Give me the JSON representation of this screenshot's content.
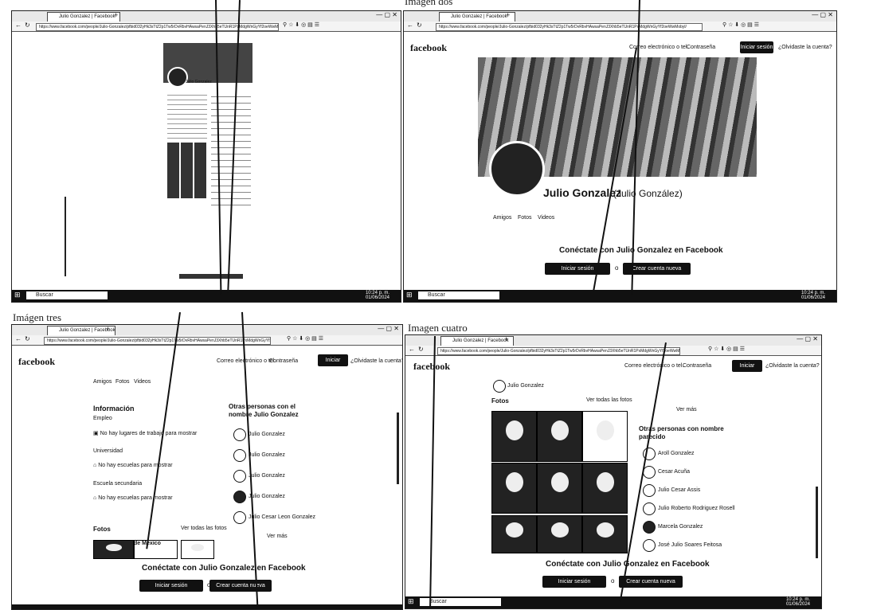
{
  "captions": {
    "two": "Imagen dos",
    "three": "Imágen tres",
    "four": "Imagen cuatro"
  },
  "browser": {
    "tab_title": "Julio Gonzalez | Facebook",
    "url": "https://www.facebook.com/people/Julio-Gonzalez/pfbid032yHk3sTtZ2p1Tw5rDvRbvHAwsaPenJ3Xhb5eTUnR1PxMdgWnGyYf2oeWwMobyl/"
  },
  "taskbar": {
    "search": "Buscar",
    "time": "10:24 p. m.",
    "date": "01/06/2024"
  },
  "fb": {
    "logo": "facebook",
    "email": "Correo electrónico o tel.",
    "password": "Contraseña",
    "login": "Iniciar sesión",
    "forgot": "¿Olvidaste la cuenta?",
    "profile_name": "Julio Gonzalez",
    "alt_name": "(Julio González)",
    "tabs": [
      "Amigos",
      "Fotos",
      "Videos"
    ],
    "connect": "Conéctate con Julio Gonzalez en Facebook",
    "create": "Crear cuenta nueva",
    "or": "o"
  },
  "info": {
    "title": "Información",
    "employment": "Empleo",
    "no_work": "No hay lugares de trabajo para mostrar",
    "university": "Universidad",
    "no_schools": "No hay escuelas para mostrar",
    "highschool": "Escuela secundaria",
    "no_schools2": "No hay escuelas para mostrar",
    "photos": "Fotos",
    "see_all": "Ver todas las fotos",
    "see_more": "Ver más"
  },
  "others_same": {
    "title": "Otras personas con el nombre Julio Gonzalez",
    "people": [
      "Julio Gonzalez",
      "Julio Gonzalez",
      "Julio Gonzalez",
      "Julio Gonzalez",
      "Julio Cesar Leon Gonzalez"
    ]
  },
  "others_similar": {
    "title": "Otras personas con nombre parecido",
    "people": [
      "Aroll Gonzalez",
      "Cesar Acuña",
      "Julio Cesar Assis",
      "Julio Roberto Rodriguez Rosell",
      "Marcela Gonzalez",
      "José Julio Soares Feitosa"
    ]
  },
  "photo_text": "de México"
}
